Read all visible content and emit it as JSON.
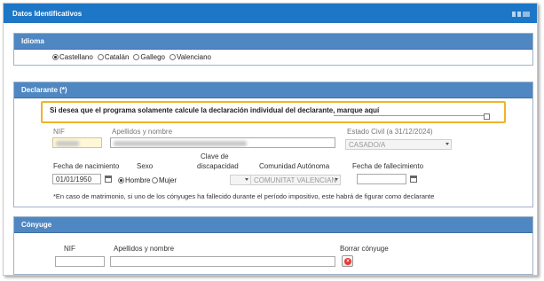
{
  "main": {
    "title": "Datos Identificativos"
  },
  "idioma": {
    "title": "Idioma",
    "options": [
      {
        "label": "Castellano",
        "checked": true
      },
      {
        "label": "Catalán",
        "checked": false
      },
      {
        "label": "Gallego",
        "checked": false
      },
      {
        "label": "Valenciano",
        "checked": false
      }
    ]
  },
  "declarante": {
    "title": "Declarante (*)",
    "individual_prompt": "Si desea que el programa solamente calcule la declaración individual del declarante, marque aquí",
    "nif_label": "NIF",
    "apellidos_label": "Apellidos y nombre",
    "estado_civil_label": "Estado Civil (a 31/12/2024)",
    "estado_civil_value": "CASADO/A",
    "fecha_nacimiento_label": "Fecha de nacimiento",
    "fecha_nacimiento_value": "01/01/1950",
    "sexo_label": "Sexo",
    "sexo_options": [
      {
        "label": "Hombre",
        "checked": true
      },
      {
        "label": "Mujer",
        "checked": false
      }
    ],
    "clave_label_1": "Clave de",
    "clave_label_2": "discapacidad",
    "comunidad_label": "Comunidad Autónoma",
    "comunidad_value": "COMUNITAT VALENCIAN",
    "fallecimiento_label": "Fecha de fallecimiento",
    "note": "*En caso de matrimonio, si uno de los cónyuges ha fallecido durante el período impositivo, este habrá de figurar como declarante"
  },
  "conyuge": {
    "title": "Cónyuge",
    "nif_label": "NIF",
    "apellidos_label": "Apellidos y nombre",
    "borrar_label": "Borrar cónyuge",
    "delete_glyph": "×"
  },
  "colors": {
    "header_blue": "#1d76c6",
    "section_blue": "#4f87c3",
    "highlight_border": "#f0b429",
    "delete_red": "#e53935"
  }
}
